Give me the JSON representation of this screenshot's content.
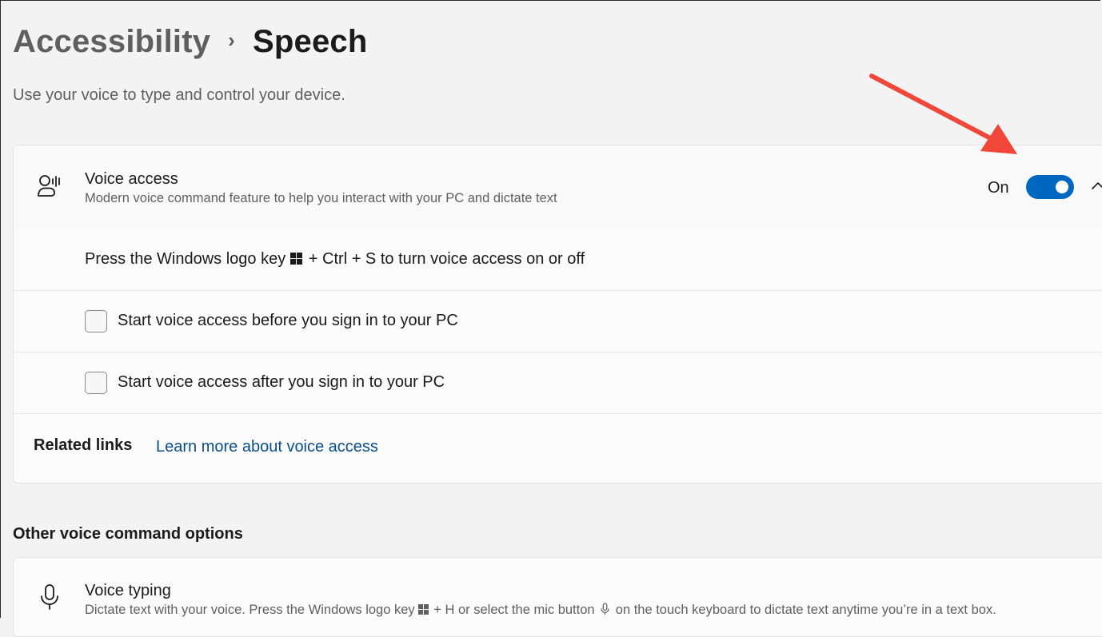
{
  "breadcrumb": {
    "parent": "Accessibility",
    "separator": "›",
    "current": "Speech"
  },
  "subtitle": "Use your voice to type and control your device.",
  "voice_access": {
    "icon": "voice-access-icon",
    "title": "Voice access",
    "description": "Modern voice command feature to help you interact with your PC and dictate text",
    "toggle_state_label": "On",
    "toggle_on": true,
    "accent_color": "#0067c0",
    "shortcut": {
      "before": "Press the Windows logo key",
      "after": "+ Ctrl + S to turn voice access on or off"
    },
    "options": [
      {
        "label": "Start voice access before you sign in to your PC",
        "checked": false
      },
      {
        "label": "Start voice access after you sign in to your PC",
        "checked": false
      }
    ],
    "related_links_label": "Related links",
    "related_link": "Learn more about voice access"
  },
  "other_options": {
    "heading": "Other voice command options",
    "voice_typing": {
      "icon": "microphone-icon",
      "title": "Voice typing",
      "desc_part1": "Dictate text with your voice. Press the Windows logo key",
      "desc_part2": "+ H or select the mic button",
      "desc_part3": "on the touch keyboard to dictate text anytime you’re in a text box."
    }
  },
  "annotation": {
    "arrow_color": "#f0473a"
  }
}
